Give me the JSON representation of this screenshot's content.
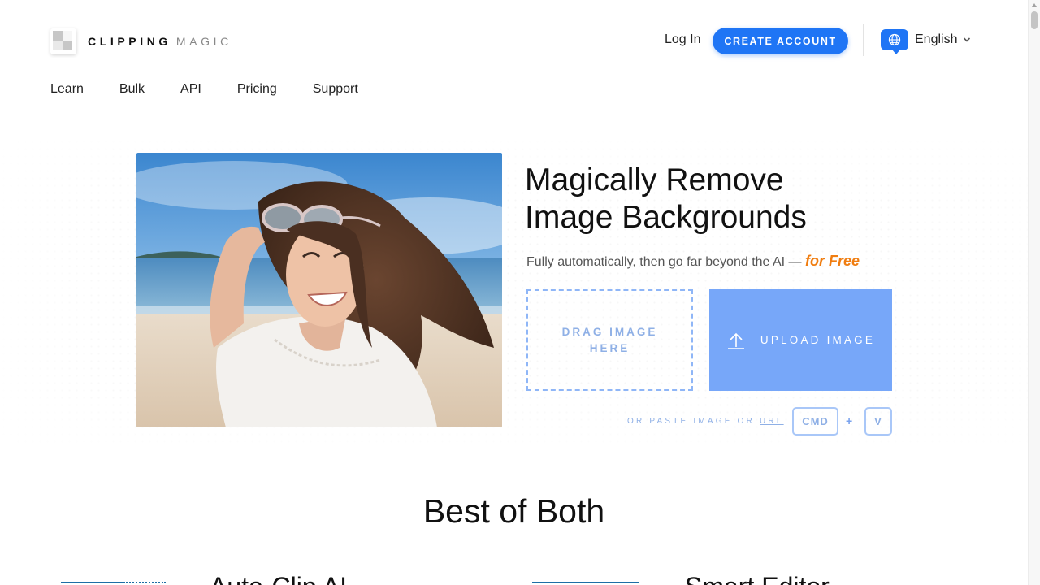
{
  "header": {
    "logo_primary": "CLIPPING",
    "logo_secondary": "MAGIC",
    "login_label": "Log In",
    "create_account_label": "CREATE ACCOUNT",
    "language_label": "English",
    "accent_color": "#1f75f5"
  },
  "nav": {
    "items": [
      {
        "label": "Learn"
      },
      {
        "label": "Bulk"
      },
      {
        "label": "API"
      },
      {
        "label": "Pricing"
      },
      {
        "label": "Support"
      }
    ]
  },
  "hero": {
    "headline_line1": "Magically Remove",
    "headline_line2": "Image Backgrounds",
    "subtitle": "Fully automatically, then go far beyond the AI —",
    "subtitle_highlight": "for Free",
    "highlight_color": "#f07d10",
    "drag_label": "DRAG IMAGE HERE",
    "upload_label": "UPLOAD IMAGE",
    "paste_label": "OR PASTE IMAGE OR",
    "paste_link": "URL",
    "key_cmd": "CMD",
    "key_plus": "+",
    "key_v": "V"
  },
  "section": {
    "title": "Best of Both",
    "left_heading": "Auto-Clip AI",
    "right_heading": "Smart Editor"
  }
}
